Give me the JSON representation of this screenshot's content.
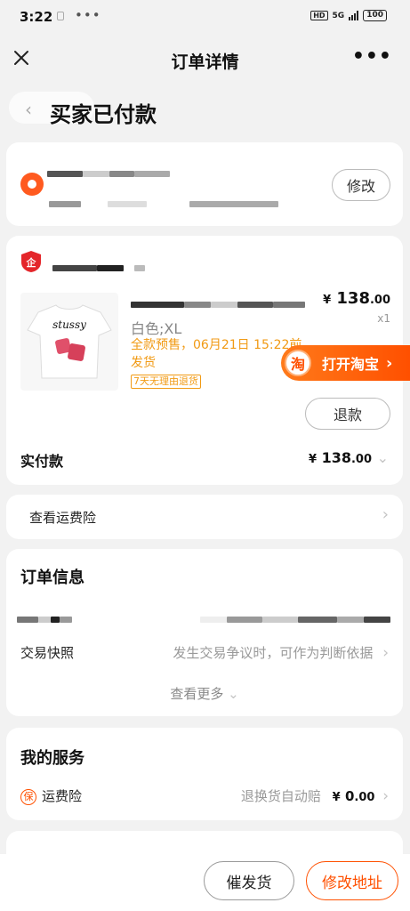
{
  "status_bar": {
    "time": "3:22",
    "dots": "•••",
    "hd": "HD",
    "network": "5G",
    "battery": "100"
  },
  "nav": {
    "title": "订单详情",
    "more": "•••"
  },
  "order_status": "买家已付款",
  "address_card": {
    "edit_label": "修改"
  },
  "product_card": {
    "attributes": "白色;XL",
    "presale_line1": "全款预售，06月21日 15:22前",
    "presale_line2": "发货",
    "return_badge": "7天无理由退货",
    "price_symbol": "¥",
    "price_int": "138",
    "price_dec": ".00",
    "quantity": "x1",
    "refund_label": "退款",
    "paid_label": "实付款",
    "paid_symbol": "¥",
    "paid_int": "138",
    "paid_dec": ".00"
  },
  "open_taobao": {
    "icon_text": "淘",
    "label": "打开淘宝"
  },
  "freight_insurance_link": "查看运费险",
  "order_info": {
    "title": "订单信息",
    "snapshot_label": "交易快照",
    "snapshot_value": "发生交易争议时，可作为判断依据",
    "see_more": "查看更多"
  },
  "services": {
    "title": "我的服务",
    "bao_icon": "保",
    "freight_label": "运费险",
    "freight_desc": "退换货自动赔",
    "fee_symbol": "¥",
    "fee_int": "0",
    "fee_dec": ".00"
  },
  "bottom": {
    "urge_label": "催发货",
    "change_address_label": "修改地址"
  },
  "colors": {
    "accent": "#ff5000",
    "presale": "#f19a14",
    "background": "#f2f2f2"
  }
}
